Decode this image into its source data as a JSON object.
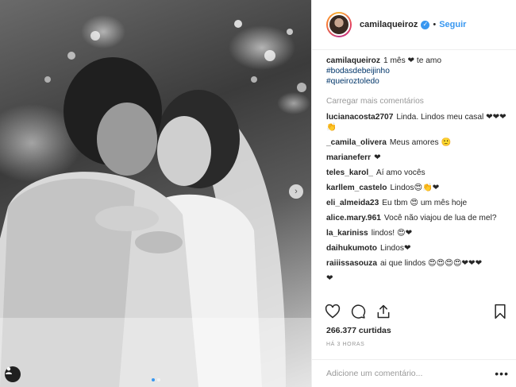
{
  "post": {
    "username": "camilaqueiroz",
    "verified_icon": "verified-badge-icon",
    "follow_label": "Seguir",
    "separator": "•",
    "caption": {
      "username": "camilaqueiroz",
      "text": "1 mês ❤ te amo",
      "hashtags": [
        "#bodasdebeijinho",
        "#queiroztoledo"
      ]
    },
    "load_more_label": "Carregar mais comentários",
    "comments": [
      {
        "user": "lucianacosta2707",
        "text": "Linda. Lindos meu casal ❤❤❤👏"
      },
      {
        "user": "_camila_olivera",
        "text": "Meus amores 🙂"
      },
      {
        "user": "marianeferr",
        "text": "❤"
      },
      {
        "user": "teles_karol_",
        "text": "Aí amo vocês"
      },
      {
        "user": "karllem_castelo",
        "text": "Lindos😍👏❤"
      },
      {
        "user": "eli_almeida23",
        "text": "Eu tbm 😍 um mês hoje"
      },
      {
        "user": "alice.mary.961",
        "text": "Você não viajou de lua de mel?"
      },
      {
        "user": "la_kariniss",
        "text": "lindos! 😍❤"
      },
      {
        "user": "daihukumoto",
        "text": "Lindos❤"
      },
      {
        "user": "raiiissasouza",
        "text": "ai que lindos 😍😍😍😍❤❤❤"
      }
    ],
    "trailing_partial": "❤",
    "likes": "266.377 curtidas",
    "time": "HÁ 3 HORAS",
    "comment_placeholder": "Adicione um comentário...",
    "more_label": "•••",
    "carousel_next_glyph": "›"
  },
  "icons": {
    "like": "heart-icon",
    "comment": "comment-icon",
    "share": "share-icon",
    "save": "bookmark-icon",
    "tag": "user-tag-icon"
  },
  "colors": {
    "link_blue": "#3897f0",
    "hashtag": "#003569",
    "muted": "#999999",
    "text": "#262626"
  }
}
